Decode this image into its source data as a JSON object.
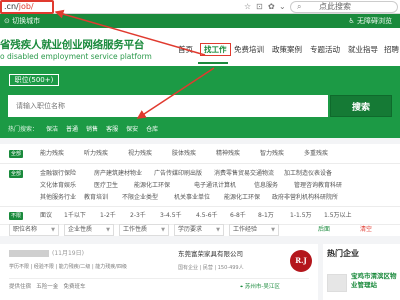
{
  "browser": {
    "url_prefix": ".cn/",
    "url_path": "job/",
    "search_placeholder": "点此搜索"
  },
  "topbar": {
    "location": "切换城市",
    "accessibility": "无障碍浏览"
  },
  "header": {
    "site_title": "省残疾人就业创业网络服务平台",
    "site_subtitle": "o disabled employment service platform",
    "nav": [
      "首页",
      "找工作",
      "免费培训",
      "政策案例",
      "专题活动",
      "就业指导",
      "招聘"
    ]
  },
  "banner": {
    "count_label": "职位(500+)",
    "search_placeholder": "请输入职位名称",
    "search_button": "搜索",
    "hot_label": "热门搜索：",
    "hot_keywords": [
      "保洁",
      "普通",
      "销售",
      "客服",
      "保安",
      "仓库"
    ]
  },
  "filters": {
    "rows": [
      {
        "tag": "全部",
        "options": [
          "能力残疾",
          "听力残疾",
          "视力残疾",
          "肢体残疾",
          "精神残疾",
          "智力残疾",
          "多重残疾"
        ]
      },
      {
        "tag": "全部",
        "options": [
          "金融银行保险",
          "房产建筑建材物业",
          "广告传媒印刷出版",
          "消费零售贸易交通物流",
          "加工制造仪表设备"
        ]
      },
      {
        "tag": "",
        "options": [
          "文化体育娱乐",
          "医疗卫生",
          "能源化工环保",
          "电子通讯计算机",
          "信息服务",
          "管理咨询教育科研"
        ]
      },
      {
        "tag": "",
        "options": [
          "其他服务行业",
          "教育培训",
          "不限企业类型",
          "机关事业单位",
          "能源化工环保",
          "政府非营利机构科研院所"
        ]
      },
      {
        "tag": "不限",
        "options": [
          "面议",
          "1千以下",
          "1-2千",
          "2-3千",
          "3-4.5千",
          "4.5-6千",
          "6-8千",
          "8-1万",
          "1-1.5万",
          "1.5万以上"
        ]
      }
    ],
    "selects": [
      "职位名称",
      "企业性质",
      "工作性质",
      "学历要求",
      "工作经验"
    ],
    "selects_link": "后面",
    "clear_link": "清空"
  },
  "job": {
    "date": "(11月19日)",
    "meta": "学历不限 | 经验不限 | 能力残疾/二级 | 能力残疾/四级",
    "company": "东莞富荣家具有限公司",
    "company_meta": "国有企业 | 民营 | 150-499人",
    "logo_text": "R.J",
    "benefits": [
      "提供住宿",
      "五险一金",
      "免费班车"
    ],
    "location": "苏州市-吴江区"
  },
  "hot_companies": {
    "title": "热门企业",
    "items": [
      {
        "name": "宝鸡市渭滨区物业管理站"
      }
    ]
  },
  "colors": {
    "brand_green": "#1a8a3c",
    "banner_green": "#1c9a45",
    "annotation_red": "#e03a2f"
  }
}
